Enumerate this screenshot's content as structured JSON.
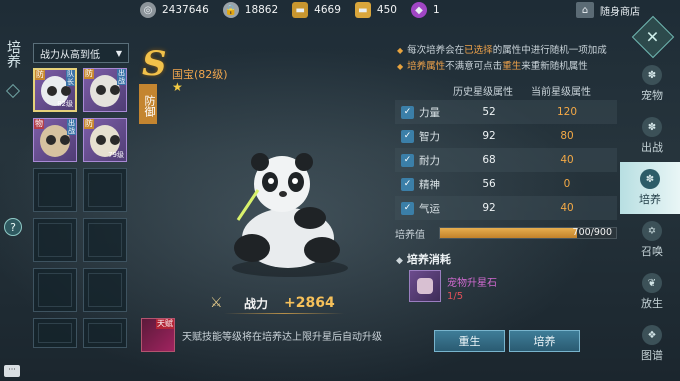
{
  "resources": [
    {
      "icon": "silver-coin-icon",
      "value": "2437646"
    },
    {
      "icon": "locked-coin-icon",
      "value": "18862"
    },
    {
      "icon": "gold-ingot-icon",
      "value": "4669"
    },
    {
      "icon": "bound-ingot-icon",
      "value": "450"
    },
    {
      "icon": "purple-gem-icon",
      "value": "1"
    }
  ],
  "shop_label": "随身商店",
  "left_title": "培养",
  "sort_label": "战力从高到低",
  "pet_slots": [
    {
      "tag": "防",
      "tag2": "队长",
      "level": "82级",
      "selected": true
    },
    {
      "tag": "防",
      "tag2": "出战",
      "level": "",
      "selected": false
    },
    {
      "tag": "物",
      "tag2": "出战",
      "level": "",
      "selected": false
    },
    {
      "tag": "防",
      "tag2": "",
      "level": "79级",
      "selected": false
    }
  ],
  "empty_slots": 8,
  "pet": {
    "grade": "S",
    "name": "国宝(82级)",
    "role": "防御",
    "stars": 1
  },
  "power": {
    "label": "战力",
    "value": "+2864"
  },
  "talent": {
    "badge": "天赋",
    "description": "天赋技能等级将在培养达上限升星后自动升级"
  },
  "notes": {
    "line1_a": "每次培养会在",
    "line1_b": "已选择",
    "line1_c": "的属性中进行随机一项加成",
    "line2_a": "培养属性",
    "line2_b": "不满意可点击",
    "line2_c": "重生",
    "line2_d": "来重新随机属性"
  },
  "attr_headers": {
    "history": "历史星级属性",
    "current": "当前星级属性"
  },
  "attributes": [
    {
      "name": "力量",
      "history": "52",
      "current": "120"
    },
    {
      "name": "智力",
      "history": "92",
      "current": "80"
    },
    {
      "name": "耐力",
      "history": "68",
      "current": "40"
    },
    {
      "name": "精神",
      "history": "56",
      "current": "0"
    },
    {
      "name": "气运",
      "history": "92",
      "current": "40"
    }
  ],
  "training": {
    "label": "培养值",
    "current": 700,
    "max": 900,
    "text": "700/900"
  },
  "cost": {
    "title": "培养消耗",
    "item_name": "宠物升星石",
    "quantity": "1/5"
  },
  "buttons": {
    "rebirth": "重生",
    "train": "培养"
  },
  "tabs": [
    {
      "label": "宠物",
      "icon": "paw-icon",
      "active": false
    },
    {
      "label": "出战",
      "icon": "paw-battle-icon",
      "active": false
    },
    {
      "label": "培养",
      "icon": "paw-train-icon",
      "active": true
    },
    {
      "label": "召唤",
      "icon": "summon-icon",
      "active": false
    },
    {
      "label": "放生",
      "icon": "release-icon",
      "active": false
    },
    {
      "label": "图谱",
      "icon": "atlas-icon",
      "active": false
    }
  ],
  "colors": {
    "accent": "#f3a946",
    "tab_active": "#d3ecee",
    "button": "#336a82"
  }
}
